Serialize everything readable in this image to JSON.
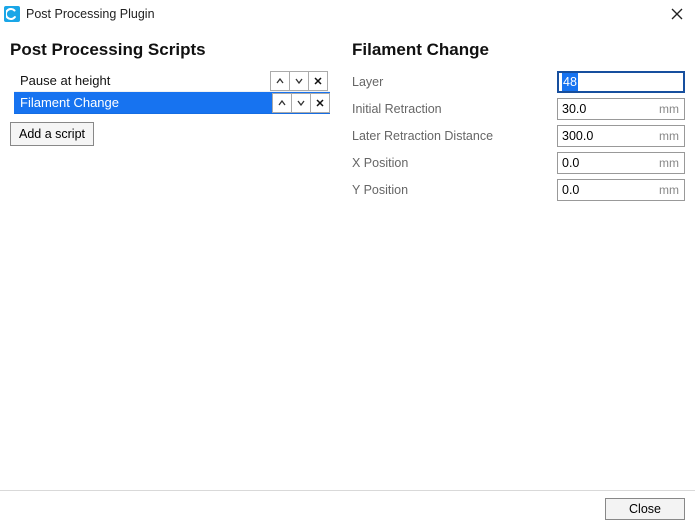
{
  "window": {
    "title": "Post Processing Plugin"
  },
  "left": {
    "title": "Post Processing Scripts",
    "scripts": [
      {
        "label": "Pause at height",
        "selected": false
      },
      {
        "label": "Filament Change",
        "selected": true
      }
    ],
    "add_button": "Add a script"
  },
  "right": {
    "title": "Filament Change",
    "fields": {
      "layer": {
        "label": "Layer",
        "value": "48",
        "unit": "",
        "focused": true
      },
      "initial_retraction": {
        "label": "Initial Retraction",
        "value": "30.0",
        "unit": "mm",
        "focused": false
      },
      "later_retraction": {
        "label": "Later Retraction Distance",
        "value": "300.0",
        "unit": "mm",
        "focused": false
      },
      "x_position": {
        "label": "X Position",
        "value": "0.0",
        "unit": "mm",
        "focused": false
      },
      "y_position": {
        "label": "Y Position",
        "value": "0.0",
        "unit": "mm",
        "focused": false
      }
    }
  },
  "footer": {
    "close": "Close"
  }
}
